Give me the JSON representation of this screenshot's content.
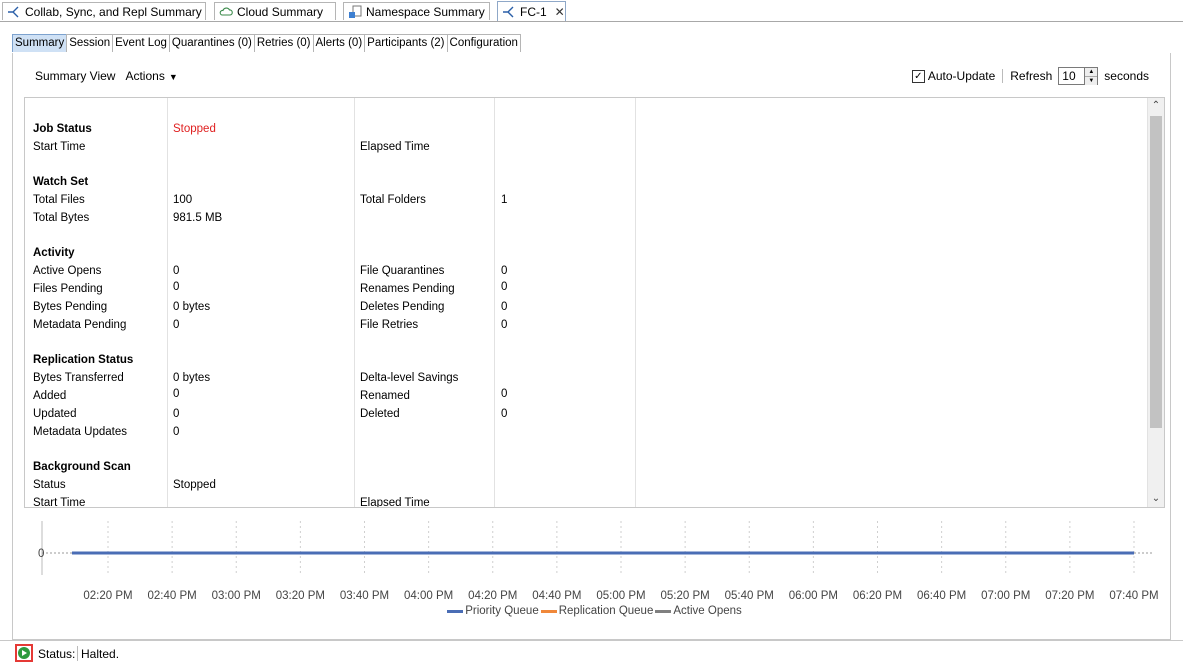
{
  "doc_tabs": [
    {
      "label": "Collab, Sync, and Repl Summary",
      "icon": "collab-icon"
    },
    {
      "label": "Cloud Summary",
      "icon": "cloud-icon"
    },
    {
      "label": "Namespace Summary",
      "icon": "namespace-icon"
    },
    {
      "label": "FC-1",
      "icon": "collab-icon",
      "close": "✕"
    }
  ],
  "sub_tabs": [
    "Summary",
    "Session",
    "Event Log",
    "Quarantines (0)",
    "Retries (0)",
    "Alerts (0)",
    "Participants (2)",
    "Configuration"
  ],
  "toolbar": {
    "summary_view": "Summary View",
    "actions": "Actions",
    "auto_update_label": "Auto-Update",
    "auto_update_checked": true,
    "refresh_label": "Refresh",
    "refresh_value": "10",
    "seconds_label": "seconds"
  },
  "summary": {
    "job_status": {
      "header": "Job Status",
      "value": "Stopped",
      "start_time": "Start Time",
      "elapsed_time": "Elapsed Time"
    },
    "watch_set": {
      "header": "Watch Set",
      "total_files_label": "Total Files",
      "total_files": "100",
      "total_bytes_label": "Total Bytes",
      "total_bytes": "981.5 MB",
      "total_folders_label": "Total Folders",
      "total_folders": "1"
    },
    "activity": {
      "header": "Activity",
      "active_opens_label": "Active Opens",
      "active_opens": "0",
      "files_pending_label": "Files Pending",
      "files_pending": "0",
      "bytes_pending_label": "Bytes Pending",
      "bytes_pending": "0 bytes",
      "metadata_pending_label": "Metadata Pending",
      "metadata_pending": "0",
      "file_quarantines_label": "File Quarantines",
      "file_quarantines": "0",
      "renames_pending_label": "Renames Pending",
      "renames_pending": "0",
      "deletes_pending_label": "Deletes Pending",
      "deletes_pending": "0",
      "file_retries_label": "File Retries",
      "file_retries": "0"
    },
    "replication": {
      "header": "Replication Status",
      "bytes_transferred_label": "Bytes Transferred",
      "bytes_transferred": "0 bytes",
      "added_label": "Added",
      "added": "0",
      "updated_label": "Updated",
      "updated": "0",
      "metadata_updates_label": "Metadata Updates",
      "metadata_updates": "0",
      "delta_savings_label": "Delta-level Savings",
      "renamed_label": "Renamed",
      "renamed": "0",
      "deleted_label": "Deleted",
      "deleted": "0"
    },
    "background_scan": {
      "header": "Background Scan",
      "status_label": "Status",
      "status": "Stopped",
      "start_time": "Start Time",
      "elapsed_time": "Elapsed Time"
    }
  },
  "chart_data": {
    "type": "line",
    "y_tick": "0",
    "x": [
      "02:20 PM",
      "02:40 PM",
      "03:00 PM",
      "03:20 PM",
      "03:40 PM",
      "04:00 PM",
      "04:20 PM",
      "04:40 PM",
      "05:00 PM",
      "05:20 PM",
      "05:40 PM",
      "06:00 PM",
      "06:20 PM",
      "06:40 PM",
      "07:00 PM",
      "07:20 PM",
      "07:40 PM"
    ],
    "series": [
      {
        "name": "Priority Queue",
        "color": "#4a6db5",
        "values": [
          0,
          0,
          0,
          0,
          0,
          0,
          0,
          0,
          0,
          0,
          0,
          0,
          0,
          0,
          0,
          0,
          0
        ]
      },
      {
        "name": "Replication Queue",
        "color": "#f0883a",
        "values": [
          0,
          0,
          0,
          0,
          0,
          0,
          0,
          0,
          0,
          0,
          0,
          0,
          0,
          0,
          0,
          0,
          0
        ]
      },
      {
        "name": "Active Opens",
        "color": "#808080",
        "values": [
          0,
          0,
          0,
          0,
          0,
          0,
          0,
          0,
          0,
          0,
          0,
          0,
          0,
          0,
          0,
          0,
          0
        ]
      }
    ]
  },
  "status_bar": {
    "label": "Status:",
    "value": "Halted."
  }
}
